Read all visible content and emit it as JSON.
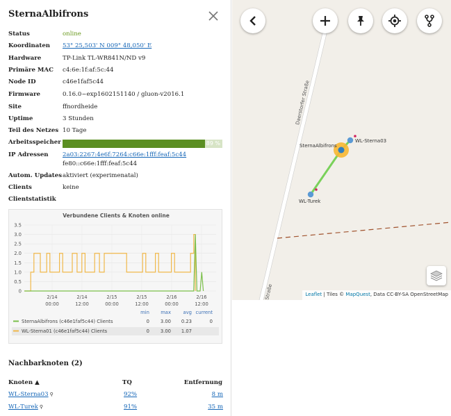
{
  "node": {
    "title": "SternaAlbifrons",
    "details": [
      {
        "label": "Status",
        "value": "online"
      },
      {
        "label": "Koordinaten",
        "value": "53° 25,503' N 009° 48,050' E"
      },
      {
        "label": "Hardware",
        "value": "TP-Link TL-WR841N/ND v9"
      },
      {
        "label": "Primäre MAC",
        "value": "c4:6e:1f:af:5c:44"
      },
      {
        "label": "Node ID",
        "value": "c46e1faf5c44"
      },
      {
        "label": "Firmware",
        "value": "0.16.0~exp1602151140 / gluon-v2016.1"
      },
      {
        "label": "Site",
        "value": "ffnordheide"
      },
      {
        "label": "Uptime",
        "value": "3 Stunden"
      },
      {
        "label": "Teil des Netzes",
        "value": "10 Tage"
      },
      {
        "label": "Arbeitsspeicher",
        "value": "89 %",
        "fraction": 0.89
      },
      {
        "label": "IP Adressen",
        "value": "2a03:2267:4e6f:7264:c66e:1fff:feaf:5c44",
        "value2": "fe80::c66e:1fff:feaf:5c44"
      },
      {
        "label": "Autom. Updates",
        "value": "aktiviert (experimenatal)"
      },
      {
        "label": "Clients",
        "value": "keine"
      },
      {
        "label": "Clientstatistik",
        "value": ""
      }
    ]
  },
  "chart_data": {
    "type": "line",
    "title": "Verbundene Clients & Knoten online",
    "ylim": [
      0,
      3.5
    ],
    "yticks": [
      "3.5",
      "3.0",
      "2.5",
      "2.0",
      "1.5",
      "1.0",
      "0.5",
      "0"
    ],
    "x_ticks": [
      {
        "day": "2/14",
        "time": "00:00"
      },
      {
        "day": "2/14",
        "time": "12:00"
      },
      {
        "day": "2/15",
        "time": "00:00"
      },
      {
        "day": "2/15",
        "time": "12:00"
      },
      {
        "day": "2/16",
        "time": "00:00"
      },
      {
        "day": "2/16",
        "time": "12:00"
      }
    ],
    "legend_headers": {
      "min": "min",
      "max": "max",
      "avg": "avg",
      "current": "current"
    },
    "series": [
      {
        "name": "SternaAlbifrons (c46e1faf5c44) Clients",
        "color": "#7bbf4a",
        "min": "0",
        "max": "3.00",
        "avg": "0.23",
        "current": "0",
        "points": [
          [
            0,
            0
          ],
          [
            10.6,
            0
          ],
          [
            10.7,
            3
          ],
          [
            10.8,
            0
          ],
          [
            11,
            0
          ],
          [
            11.1,
            1
          ],
          [
            11.2,
            0
          ]
        ]
      },
      {
        "name": "WL-Sterna01 (c46e1faf5c44) Clients",
        "color": "#f0b84a",
        "min": "0",
        "max": "3.00",
        "avg": "1.07",
        "current": "",
        "points": [
          [
            0,
            0
          ],
          [
            0.4,
            0
          ],
          [
            0.4,
            1
          ],
          [
            0.6,
            1
          ],
          [
            0.6,
            2
          ],
          [
            1.0,
            2
          ],
          [
            1.0,
            1
          ],
          [
            1.4,
            1
          ],
          [
            1.4,
            2
          ],
          [
            1.6,
            2
          ],
          [
            1.6,
            1
          ],
          [
            2.2,
            1
          ],
          [
            2.2,
            2
          ],
          [
            2.4,
            2
          ],
          [
            2.4,
            1
          ],
          [
            3.0,
            1
          ],
          [
            3.0,
            2
          ],
          [
            3.3,
            2
          ],
          [
            3.3,
            1
          ],
          [
            3.6,
            1
          ],
          [
            3.6,
            2
          ],
          [
            3.8,
            2
          ],
          [
            3.8,
            1
          ],
          [
            4.4,
            1
          ],
          [
            4.4,
            2
          ],
          [
            4.7,
            2
          ],
          [
            4.7,
            1
          ],
          [
            5.0,
            1
          ],
          [
            5.0,
            2
          ],
          [
            6.4,
            2
          ],
          [
            6.4,
            1
          ],
          [
            7.4,
            1
          ],
          [
            7.4,
            2
          ],
          [
            7.6,
            2
          ],
          [
            7.6,
            1
          ],
          [
            8.2,
            1
          ],
          [
            8.2,
            2
          ],
          [
            8.4,
            2
          ],
          [
            8.4,
            1
          ],
          [
            9.2,
            1
          ],
          [
            9.2,
            2
          ],
          [
            9.4,
            2
          ],
          [
            9.4,
            1
          ],
          [
            10.4,
            1
          ],
          [
            10.4,
            2
          ],
          [
            10.6,
            2
          ],
          [
            10.6,
            3
          ],
          [
            10.7,
            3
          ],
          [
            10.7,
            0
          ]
        ]
      }
    ]
  },
  "neighbours": {
    "title": "Nachbarknoten (2)",
    "headers": {
      "name": "Knoten ▲",
      "tq": "TQ",
      "dist": "Entfernung"
    },
    "rows": [
      {
        "name": "WL-Sterna03",
        "tq": "92%",
        "dist": "8 m"
      },
      {
        "name": "WL-Turek",
        "tq": "91%",
        "dist": "35 m"
      }
    ]
  },
  "map": {
    "street": "Daerstorfer Straße",
    "nodes": [
      "SternaAlbifrons",
      "WL-Sterna03",
      "WL-Turek"
    ],
    "attribution": {
      "leaflet": "Leaflet",
      "tiles": " | Tiles © ",
      "mapquest": "MapQuest",
      "rest": ", Data CC-BY-SA OpenStreetMap"
    },
    "buttons": [
      "back-icon",
      "zoom-in-icon",
      "pin-icon",
      "locate-icon",
      "fork-icon",
      "layers-icon"
    ]
  }
}
